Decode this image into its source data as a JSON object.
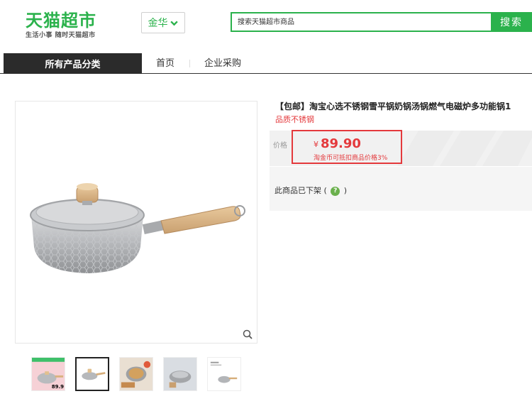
{
  "brand": {
    "logo_text": "天猫超市",
    "slogan": "生活小事 随时天猫超市"
  },
  "header": {
    "city": "金华",
    "search_placeholder": "搜索天猫超市商品",
    "search_button": "搜索"
  },
  "nav": {
    "category_label": "所有产品分类",
    "items": [
      "首页",
      "企业采购"
    ]
  },
  "product": {
    "title": "【包邮】淘宝心选不锈钢雪平锅奶锅汤锅燃气电磁炉多功能锅1",
    "subtitle": "品质不锈钢",
    "price_label": "价格",
    "currency": "¥",
    "price": "89.90",
    "price_note": "淘金币可抵扣商品价格3%",
    "status": "此商品已下架",
    "status_open": "(",
    "status_close": ")",
    "help_icon_glyph": "?"
  },
  "gallery": {
    "thumb_price_badge": "89.9",
    "active_thumb_index": 1
  },
  "colors": {
    "brand_green": "#2bb24c",
    "price_red": "#e4393c",
    "nav_dark": "#2b2b2b"
  }
}
